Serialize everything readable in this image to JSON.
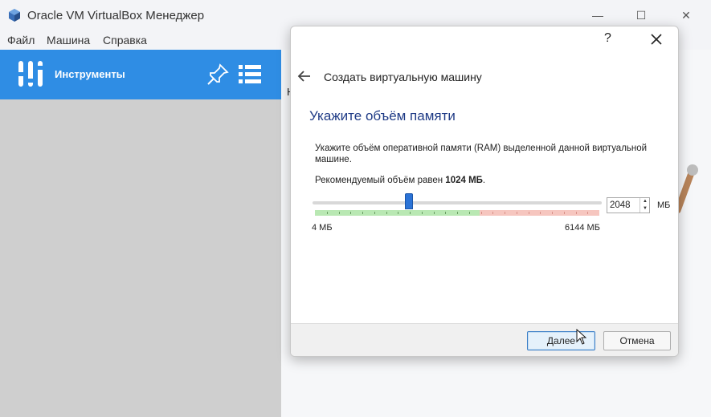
{
  "window": {
    "title": "Oracle VM VirtualBox Менеджер",
    "controls": {
      "minimize": "—",
      "maximize": "☐",
      "close": "✕"
    }
  },
  "menu": [
    "Файл",
    "Машина",
    "Справка"
  ],
  "sidebar": {
    "tools_label": "Инструменты",
    "accent": "#2f8de4"
  },
  "main": {
    "partial_text": "Н"
  },
  "dialog": {
    "help": "?",
    "title": "Создать виртуальную машину",
    "heading": "Укажите объём памяти",
    "description": "Укажите объём оперативной памяти (RAM) выделенной данной виртуальной машине.",
    "recommended_prefix": "Рекомендуемый объём равен ",
    "recommended_value": "1024 МБ",
    "recommended_suffix": ".",
    "memory": {
      "value": "2048",
      "numeric_value": 2048,
      "min": 4,
      "max": 6144,
      "min_label": "4 МБ",
      "max_label": "6144 МБ",
      "unit": "МБ",
      "green_limit_fraction": 0.58,
      "orange_limit_fraction": 0.8
    },
    "buttons": {
      "next": "Далее",
      "cancel": "Отмена"
    }
  },
  "colors": {
    "heading": "#1f3b86",
    "slider_handle": "#2b73d6",
    "scale_green": "#b9e8b3",
    "scale_red": "#f6c6bf"
  }
}
